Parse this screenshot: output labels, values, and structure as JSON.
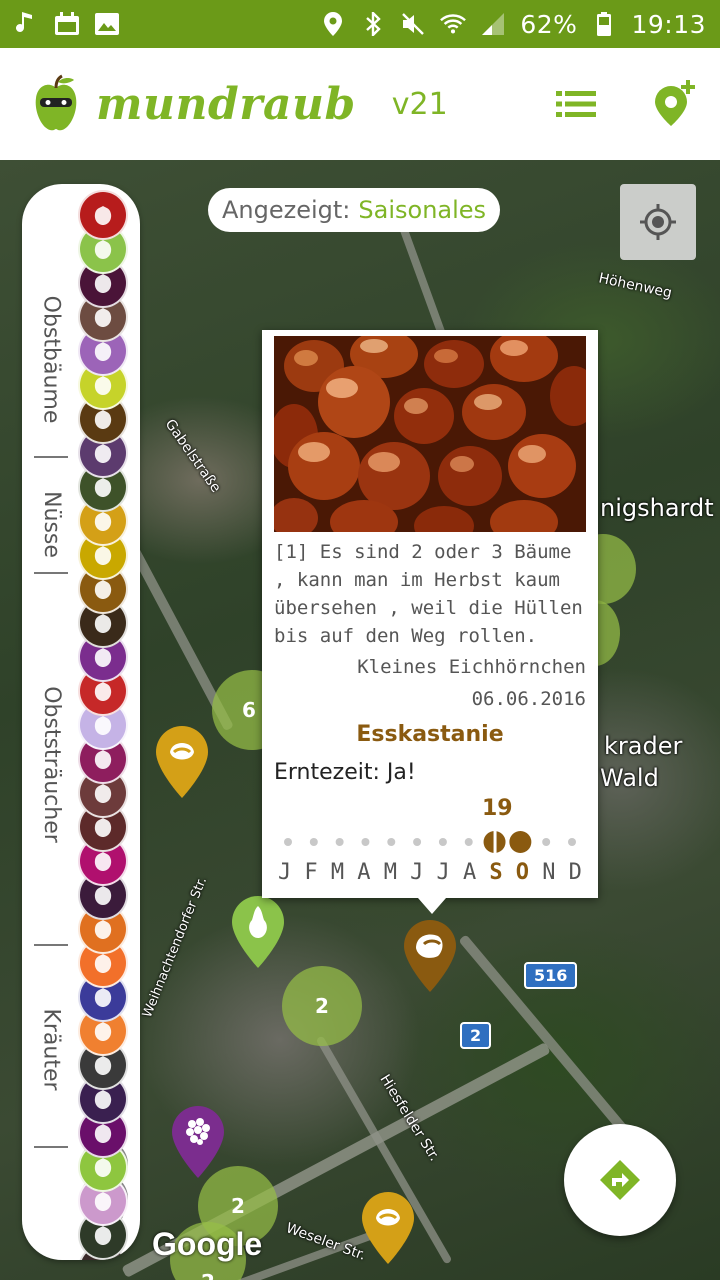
{
  "status_bar": {
    "battery": "62%",
    "time": "19:13",
    "left_icons": [
      "music-note-icon",
      "calendar-icon",
      "image-icon"
    ],
    "right_icons": [
      "location-icon",
      "bluetooth-icon",
      "mute-icon",
      "wifi-icon",
      "signal-icon",
      "battery-icon"
    ]
  },
  "app_bar": {
    "brand": "mundraub",
    "version": "v21",
    "list_icon": "list-icon",
    "add_location_icon": "add-location-icon"
  },
  "map": {
    "filter_label": "Angezeigt:",
    "filter_value": "Saisonales",
    "labels": {
      "hoehenweg": "Höhenweg",
      "gabelstrasse": "Gabelstraße",
      "koenigshardt": "nigshardt",
      "sterkrader_1": "krader",
      "sterkrader_2": "Wald",
      "weihnachtendorfer": "Weihnachtendorfer Str.",
      "hiesfelder": "Hiesfelder Str.",
      "weseler": "Weseler Str."
    },
    "badges": {
      "b516": "516",
      "b2": "2"
    },
    "clusters": {
      "c1": "6",
      "c2": "2",
      "c3": "2",
      "c4": "2"
    },
    "google": "Google",
    "colors": {
      "accent": "#7fb526",
      "status": "#6b9a18",
      "chestnut": "#8a5a10"
    }
  },
  "sidebar": {
    "categories": [
      "Obstbäume",
      "Nüsse",
      "Obststräucher",
      "Kräuter"
    ],
    "icon_colors": [
      "#b71c1c",
      "#8bc34a",
      "#4a1438",
      "#6d4c41",
      "#9c64b8",
      "#c6d32a",
      "#5a3a12",
      "#5c3b6e",
      "#3e5229",
      "#d4a017",
      "#c9a800",
      "#8a5a10",
      "#3a2a1a",
      "#7b2d8e",
      "#c62828",
      "#c5b3e6",
      "#8e1e5e",
      "#6d3b3b",
      "#5d2a2a",
      "#b0106e",
      "#3b1b3b",
      "#e07020",
      "#f2702a",
      "#3b3b9a",
      "#f08030",
      "#3a3a3a",
      "#3a2050",
      "#6a0f6a",
      "#8ec63f",
      "#cc99cc",
      "#2e3a28",
      "#3a2a2a",
      "#2a3a1a"
    ]
  },
  "popup": {
    "quote": "[1] Es sind 2 oder 3 Bäume , kann man im Herbst kaum übersehen , weil die Hüllen bis auf den Weg rollen.",
    "author": "Kleines Eichhörnchen",
    "date": "06.06.2016",
    "species": "Esskastanie",
    "harvest": "Erntezeit: Ja!",
    "day": "19",
    "months": [
      "J",
      "F",
      "M",
      "A",
      "M",
      "J",
      "J",
      "A",
      "S",
      "O",
      "N",
      "D"
    ],
    "active_months": [
      8,
      9
    ]
  }
}
